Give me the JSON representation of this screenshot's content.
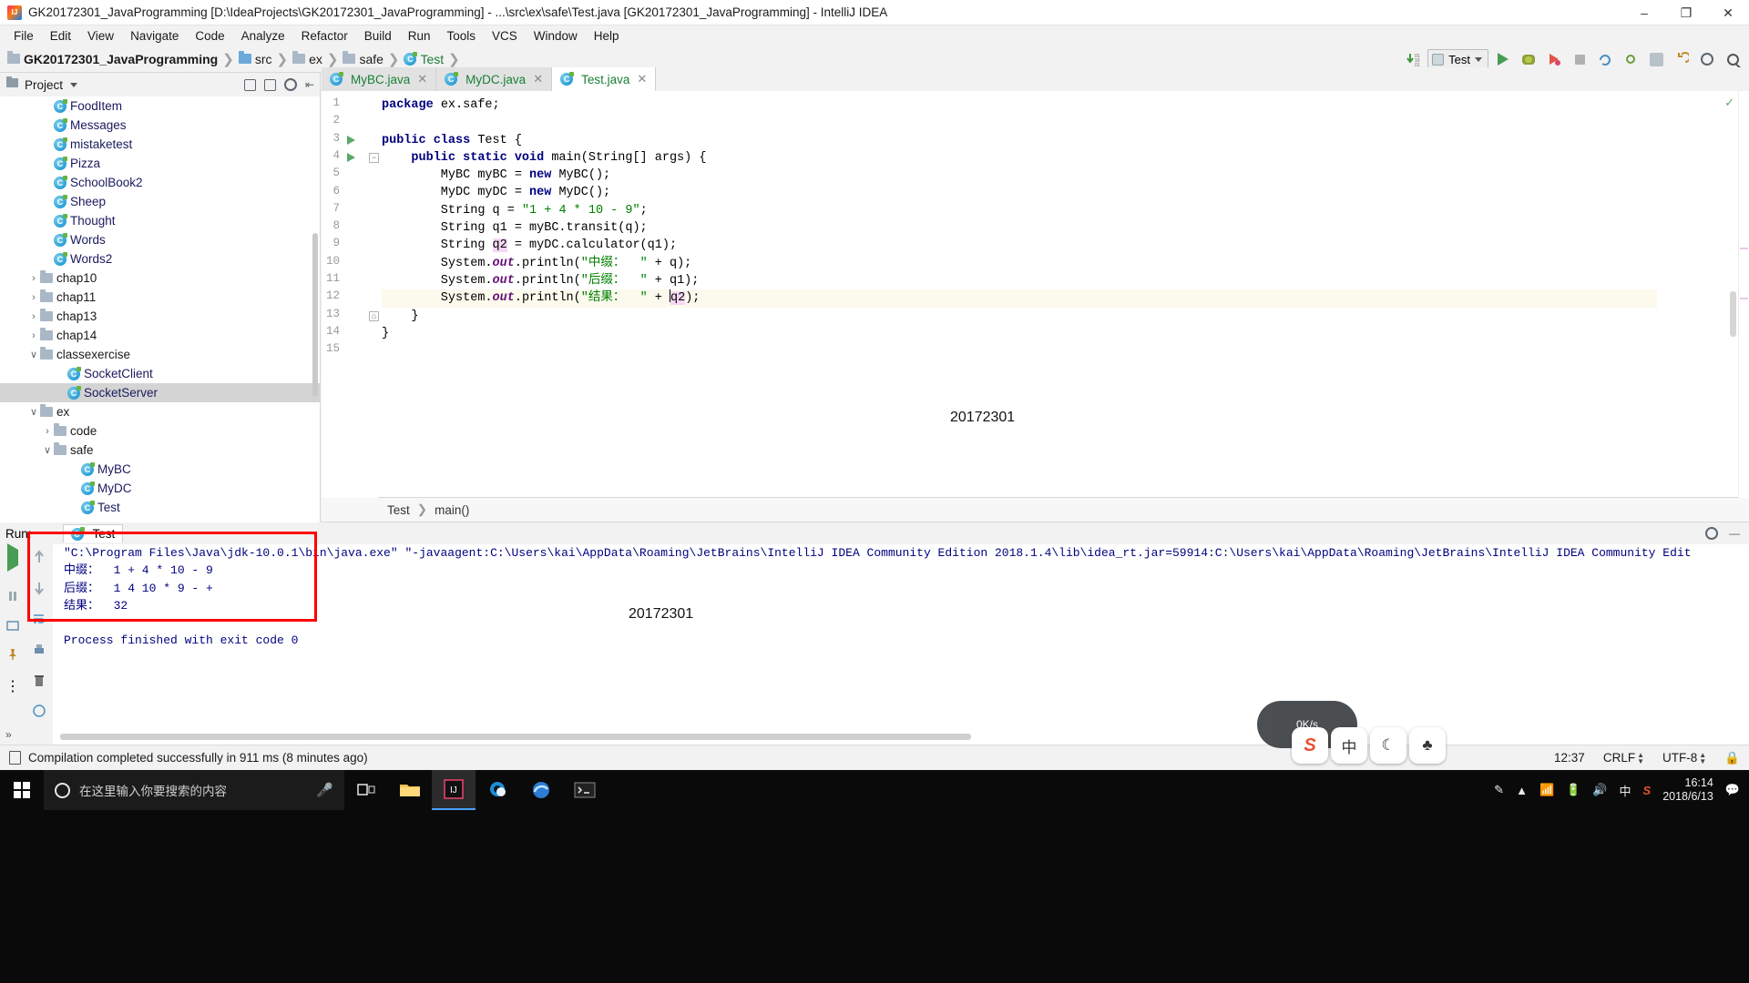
{
  "window": {
    "title": "GK20172301_JavaProgramming [D:\\IdeaProjects\\GK20172301_JavaProgramming] - ...\\src\\ex\\safe\\Test.java [GK20172301_JavaProgramming] - IntelliJ IDEA",
    "minimize": "–",
    "maximize": "❐",
    "close": "✕"
  },
  "menu": {
    "items": [
      "File",
      "Edit",
      "View",
      "Navigate",
      "Code",
      "Analyze",
      "Refactor",
      "Build",
      "Run",
      "Tools",
      "VCS",
      "Window",
      "Help"
    ]
  },
  "navbar": {
    "breadcrumbs": [
      "GK20172301_JavaProgramming",
      "src",
      "ex",
      "safe",
      "Test"
    ],
    "run_config": "Test",
    "icons": [
      "update-project-icon",
      "run-icon",
      "debug-icon",
      "run-coverage-icon",
      "stop-icon",
      "vcs-icon",
      "vcs-commit-icon",
      "vcs-update-icon",
      "undo-icon",
      "settings-icon",
      "search-icon"
    ]
  },
  "project_panel": {
    "title": "Project",
    "header_icons": [
      "collapse-icon",
      "expand-icon",
      "settings-gear-icon",
      "hide-icon"
    ],
    "tree": [
      {
        "label": "FoodItem",
        "type": "class",
        "indent": 3,
        "chevron": "",
        "selected": false
      },
      {
        "label": "Messages",
        "type": "class",
        "indent": 3,
        "chevron": "",
        "selected": false
      },
      {
        "label": "mistaketest",
        "type": "class",
        "indent": 3,
        "chevron": "",
        "selected": false
      },
      {
        "label": "Pizza",
        "type": "class",
        "indent": 3,
        "chevron": "",
        "selected": false
      },
      {
        "label": "SchoolBook2",
        "type": "class",
        "indent": 3,
        "chevron": "",
        "selected": false
      },
      {
        "label": "Sheep",
        "type": "class",
        "indent": 3,
        "chevron": "",
        "selected": false
      },
      {
        "label": "Thought",
        "type": "class",
        "indent": 3,
        "chevron": "",
        "selected": false
      },
      {
        "label": "Words",
        "type": "class",
        "indent": 3,
        "chevron": "",
        "selected": false
      },
      {
        "label": "Words2",
        "type": "class",
        "indent": 3,
        "chevron": "",
        "selected": false
      },
      {
        "label": "chap10",
        "type": "folder",
        "indent": 2,
        "chevron": "›",
        "selected": false
      },
      {
        "label": "chap11",
        "type": "folder",
        "indent": 2,
        "chevron": "›",
        "selected": false
      },
      {
        "label": "chap13",
        "type": "folder",
        "indent": 2,
        "chevron": "›",
        "selected": false
      },
      {
        "label": "chap14",
        "type": "folder",
        "indent": 2,
        "chevron": "›",
        "selected": false
      },
      {
        "label": "classexercise",
        "type": "folder",
        "indent": 2,
        "chevron": "∨",
        "selected": false
      },
      {
        "label": "SocketClient",
        "type": "class",
        "indent": 4,
        "chevron": "",
        "selected": false
      },
      {
        "label": "SocketServer",
        "type": "class",
        "indent": 4,
        "chevron": "",
        "selected": true
      },
      {
        "label": "ex",
        "type": "folder",
        "indent": 2,
        "chevron": "∨",
        "selected": false
      },
      {
        "label": "code",
        "type": "folder",
        "indent": 3,
        "chevron": "›",
        "selected": false
      },
      {
        "label": "safe",
        "type": "folder",
        "indent": 3,
        "chevron": "∨",
        "selected": false
      },
      {
        "label": "MyBC",
        "type": "class",
        "indent": 5,
        "chevron": "",
        "selected": false
      },
      {
        "label": "MyDC",
        "type": "class",
        "indent": 5,
        "chevron": "",
        "selected": false
      },
      {
        "label": "Test",
        "type": "class",
        "indent": 5,
        "chevron": "",
        "selected": false
      }
    ]
  },
  "editor": {
    "tabs": [
      {
        "label": "MyBC.java",
        "active": false
      },
      {
        "label": "MyDC.java",
        "active": false
      },
      {
        "label": "Test.java",
        "active": true
      }
    ],
    "lines": [
      {
        "n": "1",
        "run": false,
        "fold": "",
        "html": "<span class=\"kw\">package</span> ex.safe;"
      },
      {
        "n": "2",
        "run": false,
        "fold": "",
        "html": ""
      },
      {
        "n": "3",
        "run": true,
        "fold": "",
        "html": "<span class=\"kw\">public class</span> Test {"
      },
      {
        "n": "4",
        "run": true,
        "fold": "−",
        "html": "    <span class=\"kw\">public static void</span> main(String[] args) {"
      },
      {
        "n": "5",
        "run": false,
        "fold": "",
        "html": "        MyBC myBC = <span class=\"kw\">new</span> MyBC();"
      },
      {
        "n": "6",
        "run": false,
        "fold": "",
        "html": "        MyDC myDC = <span class=\"kw\">new</span> MyDC();"
      },
      {
        "n": "7",
        "run": false,
        "fold": "",
        "html": "        String q = <span class=\"str\">\"1 + 4 * 10 - 9\"</span>;"
      },
      {
        "n": "8",
        "run": false,
        "fold": "",
        "html": "        String q1 = myBC.transit(q);"
      },
      {
        "n": "9",
        "run": false,
        "fold": "",
        "html": "        String <span class=\"hi\">q2</span> = myDC.calculator(q1);"
      },
      {
        "n": "10",
        "run": false,
        "fold": "",
        "html": "        System.<span class=\"fld\">out</span>.println(<span class=\"str\">\"中缀：  \"</span> + q);"
      },
      {
        "n": "11",
        "run": false,
        "fold": "",
        "html": "        System.<span class=\"fld\">out</span>.println(<span class=\"str\">\"后缀：  \"</span> + q1);"
      },
      {
        "n": "12",
        "run": false,
        "fold": "",
        "html": "        System.<span class=\"fld\">out</span>.println(<span class=\"str\">\"结果：  \"</span> + <span class=\"caretbar\"></span><span class=\"hi\">q2</span>);",
        "highlight": true
      },
      {
        "n": "13",
        "run": false,
        "fold": "⌂",
        "html": "    }"
      },
      {
        "n": "14",
        "run": false,
        "fold": "",
        "html": "}"
      },
      {
        "n": "15",
        "run": false,
        "fold": "",
        "html": ""
      }
    ],
    "watermark": "20172301",
    "breadcrumbs": [
      "Test",
      "main()"
    ]
  },
  "run_window": {
    "title": "Run:",
    "tab": "Test",
    "sidebar_icons": [
      "rerun-icon",
      "scroll-up-icon",
      "scroll-down-icon",
      "soft-wrap-icon",
      "print-icon",
      "clear-all-icon"
    ],
    "side_icons_2": [
      "rerun-icon",
      "stop-icon",
      "pause-icon",
      "restore-layout-icon",
      "trash-icon",
      "pin-icon",
      "more-icon"
    ],
    "header_icons": [
      "settings-gear-icon",
      "hide-window-icon"
    ],
    "console_lines": [
      "\"C:\\Program Files\\Java\\jdk-10.0.1\\bin\\java.exe\" \"-javaagent:C:\\Users\\kai\\AppData\\Roaming\\JetBrains\\IntelliJ IDEA Community Edition 2018.1.4\\lib\\idea_rt.jar=59914:C:\\Users\\kai\\AppData\\Roaming\\JetBrains\\IntelliJ IDEA Community Edit",
      "中缀：  1 + 4 * 10 - 9",
      "后缀：  1 4 10 * 9 - +",
      "结果：  32",
      "",
      "Process finished with exit code 0"
    ],
    "watermark": "20172301"
  },
  "statusbar": {
    "message": "Compilation completed successfully in 911 ms (8 minutes ago)",
    "position": "12:37",
    "line_separator": "CRLF",
    "encoding": "UTF-8"
  },
  "taskbar": {
    "search_placeholder": "在这里输入你要搜索的内容",
    "apps": [
      "task-view-icon",
      "file-explorer-icon",
      "intellij-idea-icon",
      "cortana-icon",
      "edge-icon",
      "terminal-icon"
    ],
    "tray_icons": [
      "pen-icon",
      "chevron-up-icon",
      "network-icon",
      "battery-icon",
      "volume-icon",
      "ime-cn-icon",
      "sogou-icon"
    ],
    "ime_lang": "中",
    "clock_time": "16:14",
    "clock_date": "2018/6/13",
    "notification": "notification-icon"
  },
  "floating": {
    "speed": "0K/s",
    "ime_keys": [
      "sogou-logo",
      "中",
      "☾",
      "♣"
    ]
  },
  "colors": {
    "accent_green": "#59a869",
    "keyword_blue": "#000080",
    "string_green": "#008000",
    "red_annotation": "#ff0000",
    "selection_gray": "#d4d4d4"
  }
}
